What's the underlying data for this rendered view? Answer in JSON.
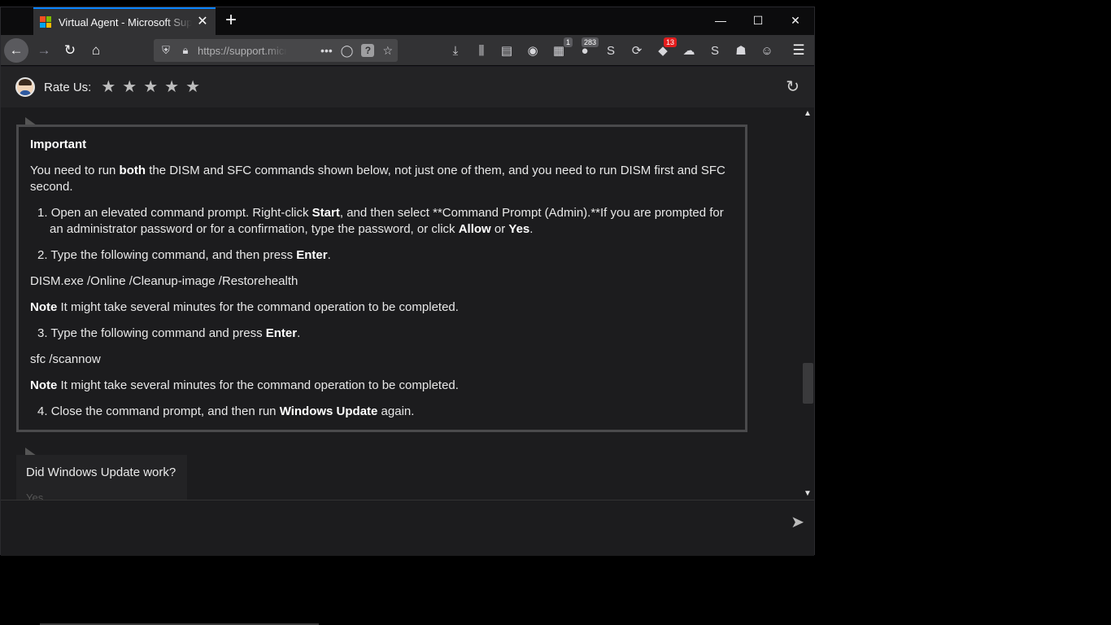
{
  "browser": {
    "tab_title": "Virtual Agent - Microsoft Support",
    "new_tab_label": "+",
    "minimize": "—",
    "maximize": "☐",
    "close": "✕",
    "url": "https://support.microsoft.com",
    "extensions": [
      {
        "name": "downloads-icon",
        "glyph": "⤓",
        "badge": ""
      },
      {
        "name": "library-icon",
        "glyph": "⫼",
        "badge": ""
      },
      {
        "name": "sidebar-icon",
        "glyph": "▤",
        "badge": ""
      },
      {
        "name": "account-icon",
        "glyph": "◉",
        "badge": ""
      },
      {
        "name": "extension-green-icon",
        "glyph": "▦",
        "badge": "1"
      },
      {
        "name": "extension-red-icon",
        "glyph": "●",
        "badge": "283"
      },
      {
        "name": "extension-s-icon",
        "glyph": "S",
        "badge": ""
      },
      {
        "name": "extension-sync-icon",
        "glyph": "⟳",
        "badge": ""
      },
      {
        "name": "extension-notify-icon",
        "glyph": "◆",
        "badge": "13"
      },
      {
        "name": "extension-cloud-icon",
        "glyph": "☁",
        "badge": ""
      },
      {
        "name": "extension-skype-icon",
        "glyph": "S",
        "badge": ""
      },
      {
        "name": "extension-people-icon",
        "glyph": "☗",
        "badge": ""
      },
      {
        "name": "extension-spy-icon",
        "glyph": "☺",
        "badge": ""
      }
    ],
    "menu_icon": "☰"
  },
  "header": {
    "rate_label": "Rate Us:",
    "stars": [
      "★",
      "★",
      "★",
      "★",
      "★"
    ]
  },
  "card": {
    "heading": "Important",
    "intro_pre": "You need to run ",
    "intro_bold": "both",
    "intro_post": " the DISM and SFC commands shown below, not just one of them, and you need to run DISM first and SFC second.",
    "step1": {
      "num": "1.",
      "a": "Open an elevated command prompt. Right-click ",
      "b": "Start",
      "c": ", and then select **Command Prompt (Admin).**If you are prompted for an administrator password or for a confirmation, type the password, or click ",
      "d": "Allow",
      "e": " or ",
      "f": "Yes",
      "g": "."
    },
    "step2": {
      "num": "2.",
      "a": "Type the following command, and then press ",
      "b": "Enter",
      "c": "."
    },
    "dism_cmd": "DISM.exe /Online /Cleanup-image /Restorehealth",
    "note1_label": "Note",
    "note1_text": " It might take several minutes for the command operation to be completed.",
    "step3": {
      "num": "3.",
      "a": "Type the following command and press ",
      "b": "Enter",
      "c": "."
    },
    "sfc_cmd": "sfc /scannow",
    "note2_label": "Note",
    "note2_text": " It might take several minutes for the command operation to be completed.",
    "step4": {
      "num": "4.",
      "a": "Close the command prompt, and then run ",
      "b": "Windows Update",
      "c": " again."
    }
  },
  "question": {
    "text": "Did Windows Update work?",
    "faded_option": "Yes"
  }
}
